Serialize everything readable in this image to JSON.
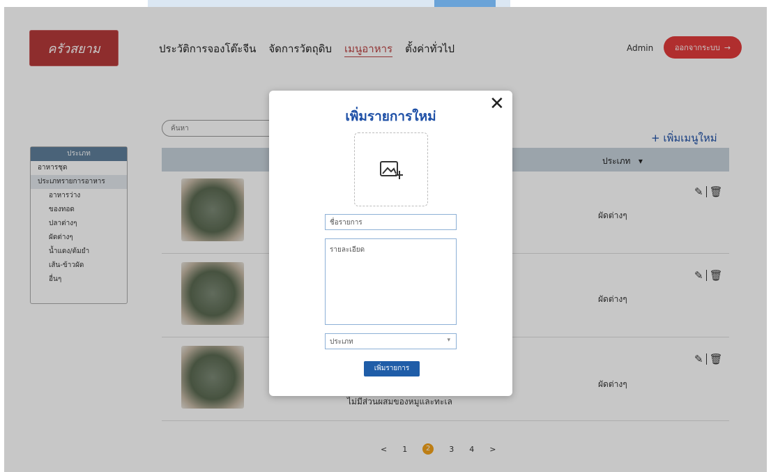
{
  "logo": {
    "text": "ครัวสยาม"
  },
  "nav": {
    "items": [
      {
        "label": "ประวัติการจองโต๊ะจีน"
      },
      {
        "label": "จัดการวัตถุดิบ"
      },
      {
        "label": "เมนูอาหาร"
      },
      {
        "label": "ตั้งค่าทั่วไป"
      }
    ]
  },
  "header": {
    "admin": "Admin",
    "logout": "ออกจากระบบ",
    "logout_icon": "→"
  },
  "search": {
    "placeholder": "ค้นหา"
  },
  "add_menu": "+ เพิ่มเมนูใหม่",
  "sidebar": {
    "header": "ประเภท",
    "items": [
      {
        "label": "อาหารชุด"
      },
      {
        "label": "ประเภทรายการอาหาร"
      },
      {
        "label": "อาหารว่าง"
      },
      {
        "label": "ของทอด"
      },
      {
        "label": "ปลาต่างๆ"
      },
      {
        "label": "ผัดต่างๆ"
      },
      {
        "label": "น้ำแดง/ต้มยำ"
      },
      {
        "label": "เส้น-ข้าวผัด"
      },
      {
        "label": "อื่นๆ"
      }
    ]
  },
  "table": {
    "category_header": "ประเภท",
    "sort_icon": "▾",
    "rows": [
      {
        "category": "ผัดต่างๆ"
      },
      {
        "category": "ผัดต่างๆ"
      },
      {
        "category": "ผัดต่างๆ"
      }
    ],
    "row3_description": "ไม่มีส่วนผสมของหมูและทะเล"
  },
  "pagination": {
    "prev": "<",
    "pages": [
      "1",
      "2",
      "3",
      "4"
    ],
    "current": "2",
    "next": ">"
  },
  "modal": {
    "title": "เพิ่มรายการใหม่",
    "close": "✕",
    "name_placeholder": "ชื่อรายการ",
    "detail_placeholder": "รายละเอียด",
    "type_placeholder": "ประเภท",
    "type_arrow": "▾",
    "submit": "เพิ่มรายการ"
  },
  "colors": {
    "accent": "#1d4fa6",
    "danger": "#e23b3b",
    "page_current": "#f3a21a"
  }
}
